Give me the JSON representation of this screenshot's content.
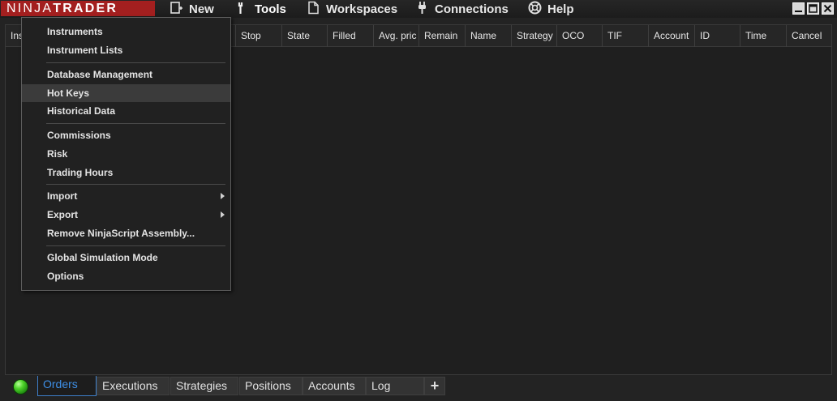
{
  "app": {
    "logo_light": "NINJA",
    "logo_bold": "TRADER"
  },
  "menubar": {
    "items": [
      {
        "label": "New",
        "icon": "new-document-icon"
      },
      {
        "label": "Tools",
        "icon": "wrench-icon"
      },
      {
        "label": "Workspaces",
        "icon": "document-icon"
      },
      {
        "label": "Connections",
        "icon": "plug-icon"
      },
      {
        "label": "Help",
        "icon": "lifebuoy-icon"
      }
    ],
    "window_controls": [
      "minimize-icon",
      "maximize-icon",
      "close-icon"
    ]
  },
  "orders_grid": {
    "columns": [
      "Ins",
      "Stop",
      "State",
      "Filled",
      "Avg. pric",
      "Remain",
      "Name",
      "Strategy",
      "OCO",
      "TIF",
      "Account",
      "ID",
      "Time",
      "Cancel"
    ]
  },
  "tools_menu": {
    "items": [
      {
        "label": "Instruments"
      },
      {
        "label": "Instrument Lists"
      },
      {
        "label": "Database Management"
      },
      {
        "label": "Hot Keys",
        "highlighted": true
      },
      {
        "label": "Historical Data"
      },
      {
        "label": "Commissions"
      },
      {
        "label": "Risk"
      },
      {
        "label": "Trading Hours"
      },
      {
        "label": "Import",
        "submenu": true
      },
      {
        "label": "Export",
        "submenu": true
      },
      {
        "label": "Remove NinjaScript Assembly..."
      },
      {
        "label": "Global Simulation Mode"
      },
      {
        "label": "Options"
      }
    ]
  },
  "tabs": {
    "items": [
      "Orders",
      "Executions",
      "Strategies",
      "Positions",
      "Accounts",
      "Log"
    ],
    "active": "Orders",
    "add_label": "+"
  },
  "status": {
    "connection_led_color": "#3fcf1f"
  }
}
